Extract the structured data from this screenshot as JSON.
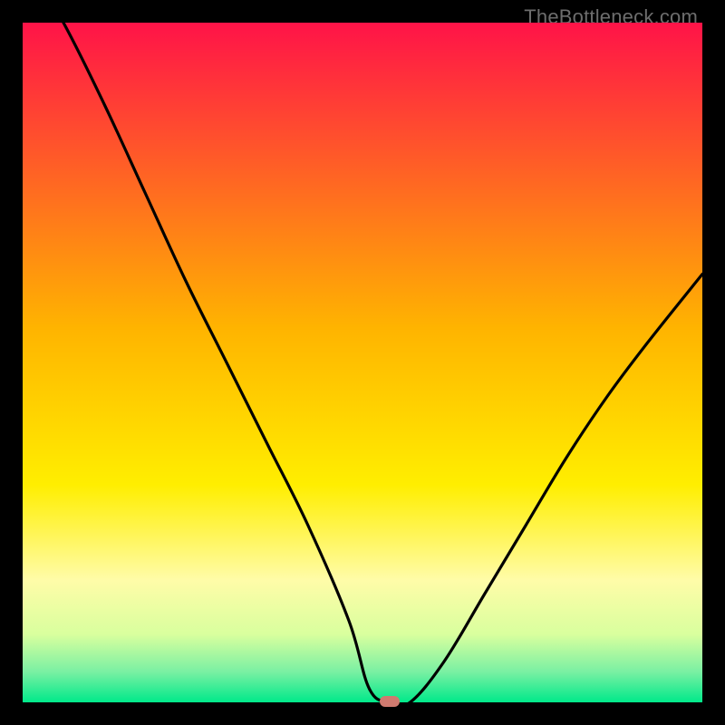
{
  "watermark": "TheBottleneck.com",
  "chart_data": {
    "type": "line",
    "title": "",
    "xlabel": "",
    "ylabel": "",
    "xlim": [
      0,
      100
    ],
    "ylim": [
      0,
      100
    ],
    "grid": false,
    "legend": null,
    "marker": {
      "x": 54,
      "y": 0,
      "color": "#cf7a6f"
    },
    "gradient_stops": [
      {
        "pos": 0.0,
        "color": "#ff1348"
      },
      {
        "pos": 0.45,
        "color": "#ffb400"
      },
      {
        "pos": 0.68,
        "color": "#ffee00"
      },
      {
        "pos": 0.82,
        "color": "#fffca8"
      },
      {
        "pos": 0.9,
        "color": "#d9ff9e"
      },
      {
        "pos": 0.955,
        "color": "#7af0a3"
      },
      {
        "pos": 1.0,
        "color": "#00e98a"
      }
    ],
    "series": [
      {
        "name": "bottleneck-curve",
        "x": [
          0,
          6,
          12,
          18,
          24,
          30,
          36,
          42,
          48,
          51,
          54,
          57,
          62,
          68,
          74,
          80,
          86,
          92,
          100
        ],
        "y": [
          110,
          100,
          88,
          75,
          62,
          50,
          38,
          26,
          12,
          2,
          0,
          0,
          6,
          16,
          26,
          36,
          45,
          53,
          63
        ]
      }
    ]
  }
}
